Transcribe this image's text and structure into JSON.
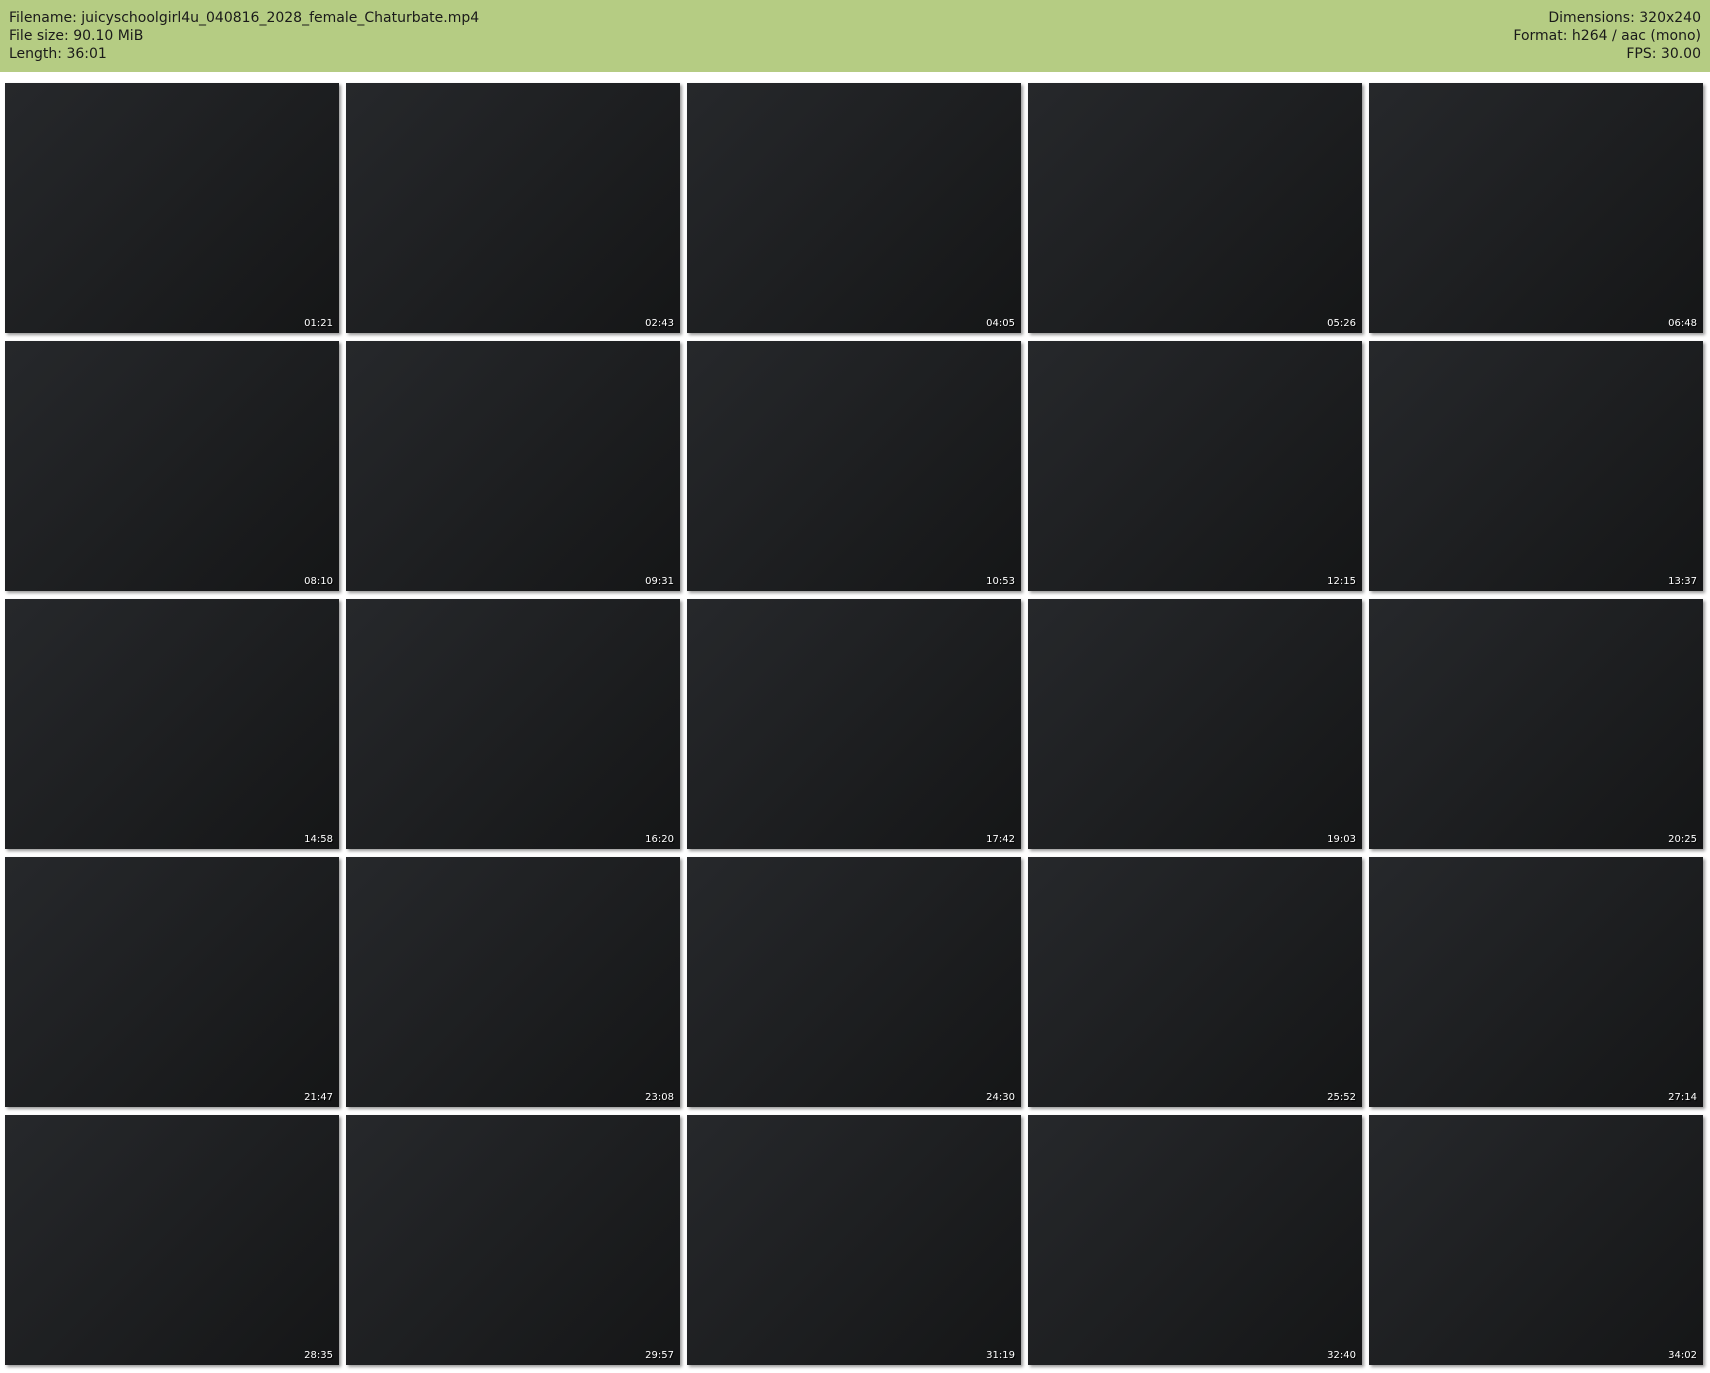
{
  "header": {
    "filename_line": "Filename: juicyschoolgirl4u_040816_2028_female_Chaturbate.mp4",
    "filesize_line": "File size: 90.10 MiB",
    "length_line": "Length: 36:01",
    "dimensions_line": "Dimensions: 320x240",
    "format_line": "Format: h264 / aac (mono)",
    "fps_line": "FPS: 30.00"
  },
  "colors": {
    "header_bg": "#b5cc83"
  },
  "thumbnails": [
    {
      "time": "01:21"
    },
    {
      "time": "02:43"
    },
    {
      "time": "04:05"
    },
    {
      "time": "05:26"
    },
    {
      "time": "06:48"
    },
    {
      "time": "08:10"
    },
    {
      "time": "09:31"
    },
    {
      "time": "10:53"
    },
    {
      "time": "12:15"
    },
    {
      "time": "13:37"
    },
    {
      "time": "14:58"
    },
    {
      "time": "16:20"
    },
    {
      "time": "17:42"
    },
    {
      "time": "19:03"
    },
    {
      "time": "20:25"
    },
    {
      "time": "21:47"
    },
    {
      "time": "23:08"
    },
    {
      "time": "24:30"
    },
    {
      "time": "25:52"
    },
    {
      "time": "27:14"
    },
    {
      "time": "28:35"
    },
    {
      "time": "29:57"
    },
    {
      "time": "31:19"
    },
    {
      "time": "32:40"
    },
    {
      "time": "34:02"
    }
  ]
}
